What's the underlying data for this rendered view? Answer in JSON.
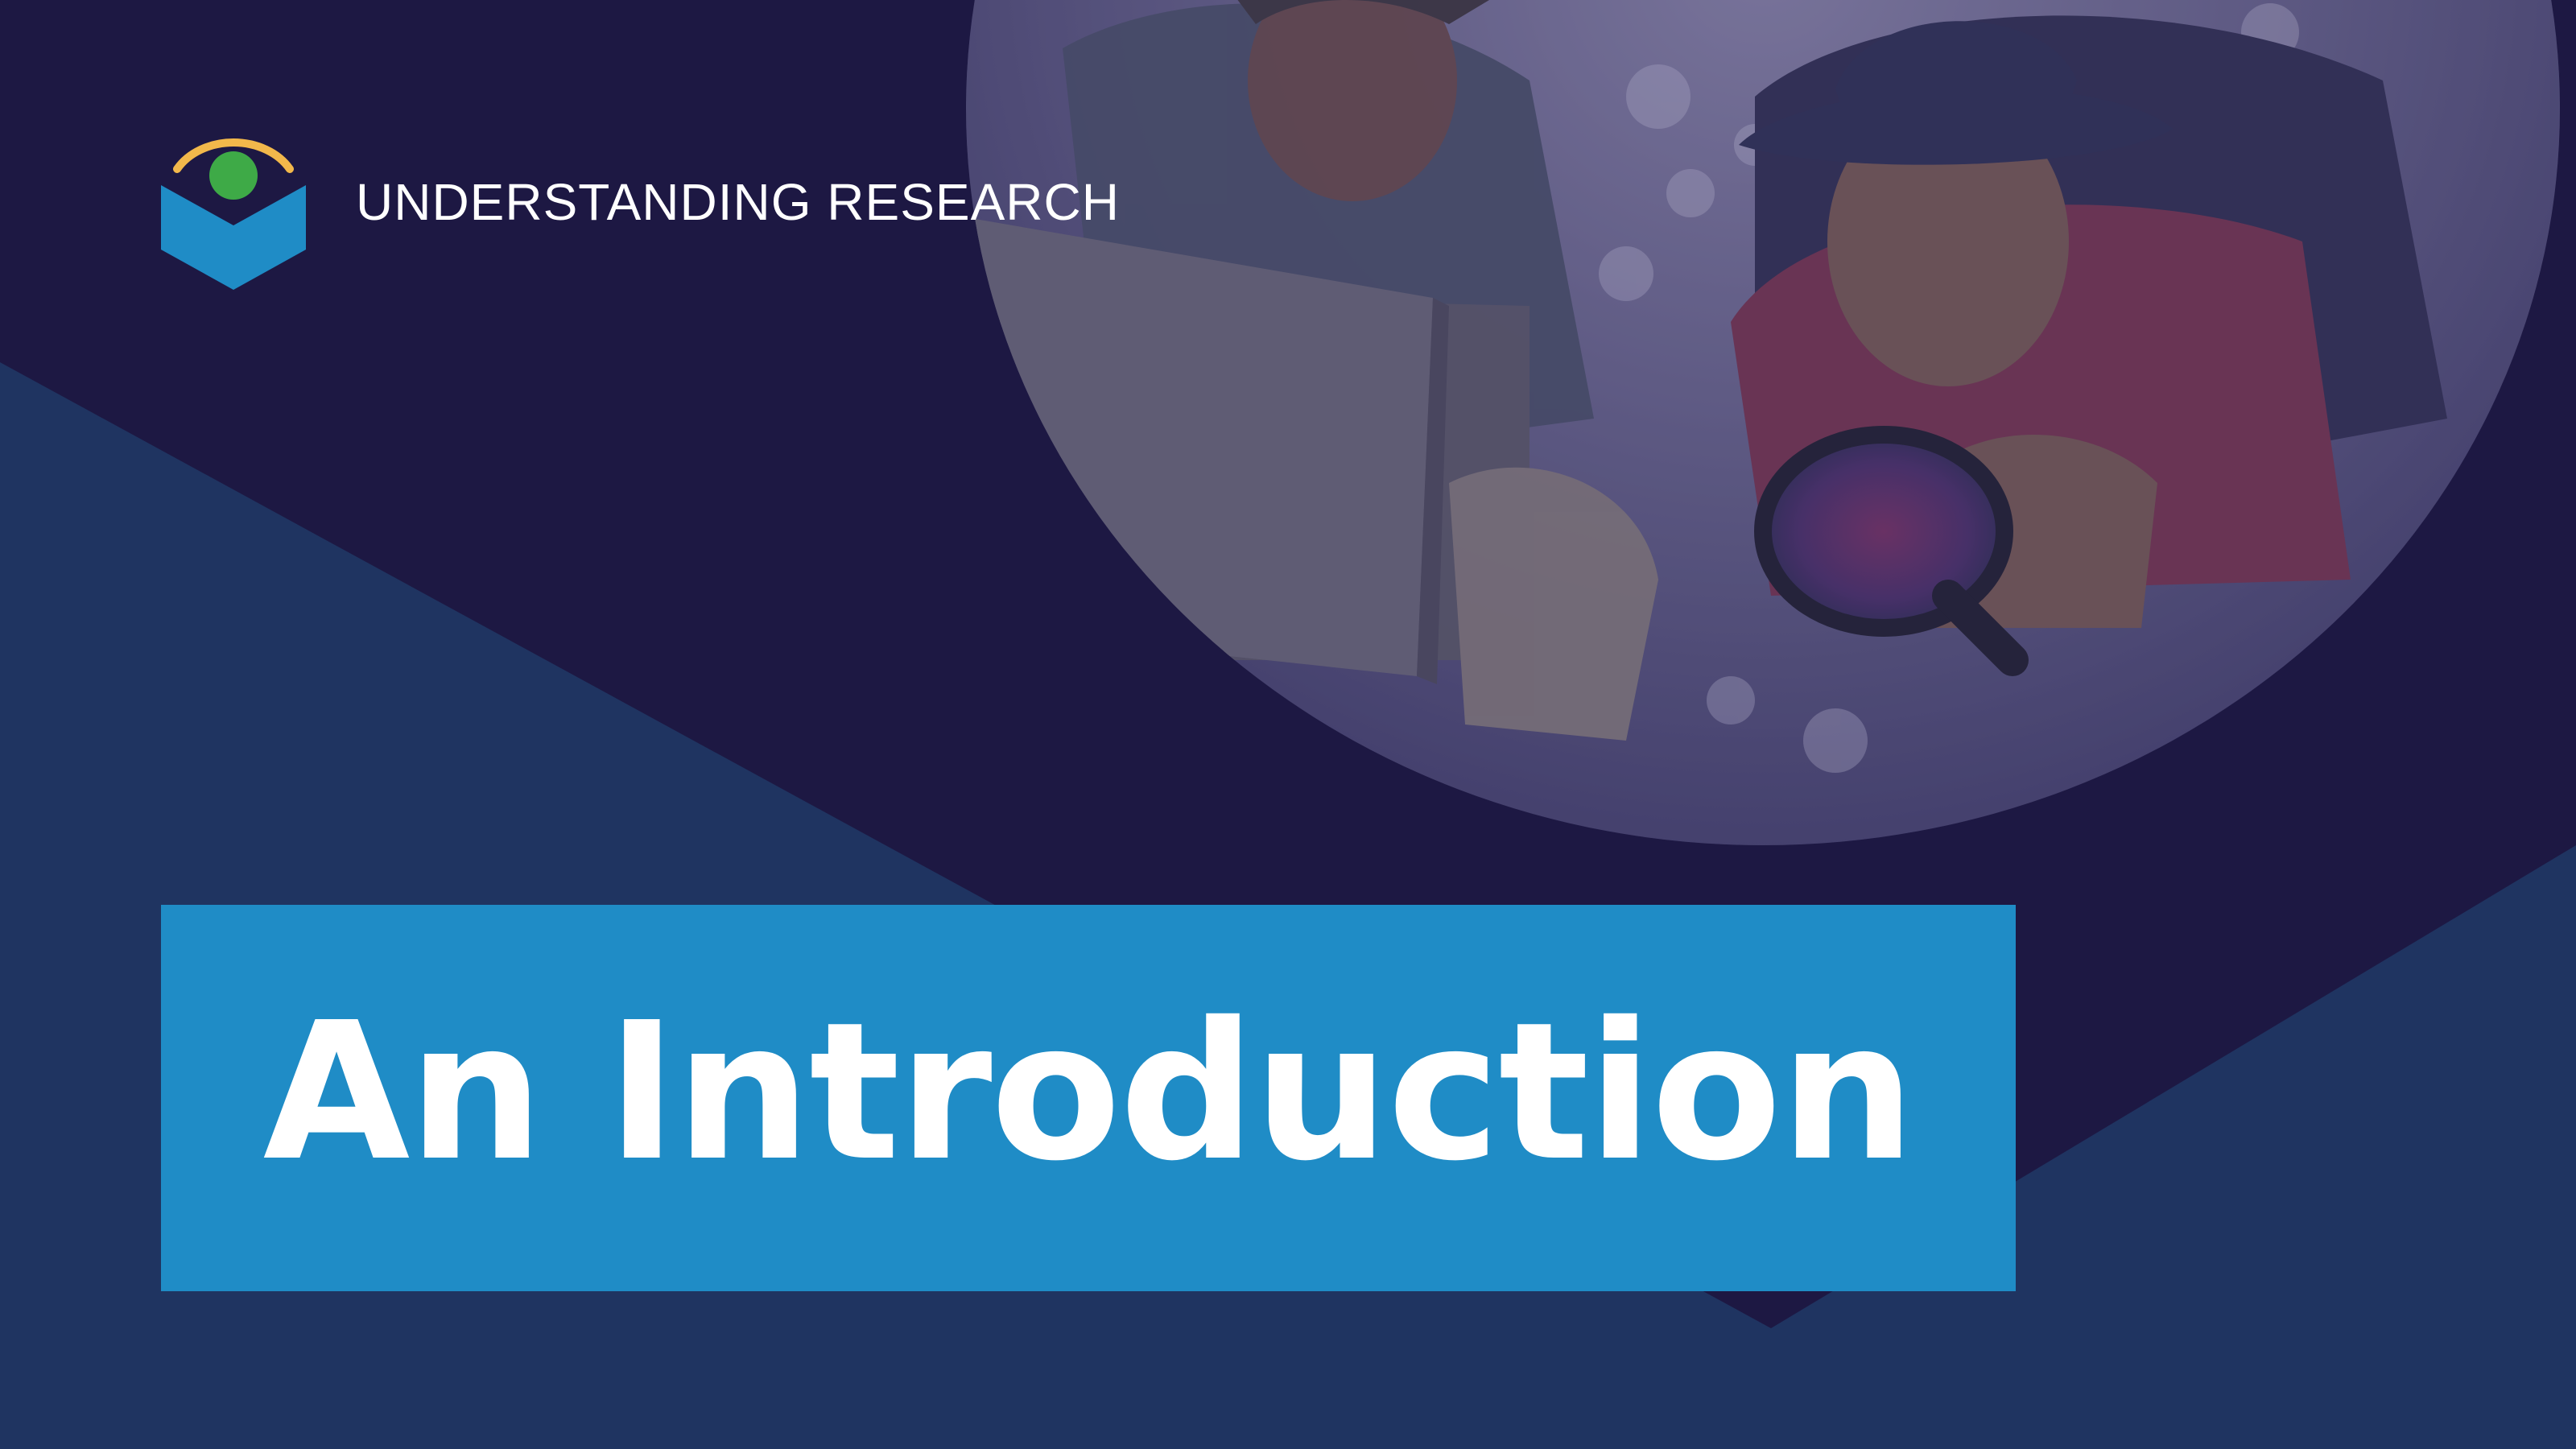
{
  "brand": {
    "name": "UNDERSTANDING RESEARCH",
    "icon": "research-eye-logo-icon"
  },
  "title": {
    "text": "An Introduction"
  },
  "hero_image": {
    "icon": "researchers-magnifying-glass-photo"
  },
  "colors": {
    "background_deep": "#1f3461",
    "background_dark": "#1d1843",
    "accent_blue": "#1f8cc6",
    "logo_gold": "#f2b84b",
    "logo_green": "#3eaa47",
    "logo_blue": "#1f8cc6",
    "text": "#ffffff"
  }
}
